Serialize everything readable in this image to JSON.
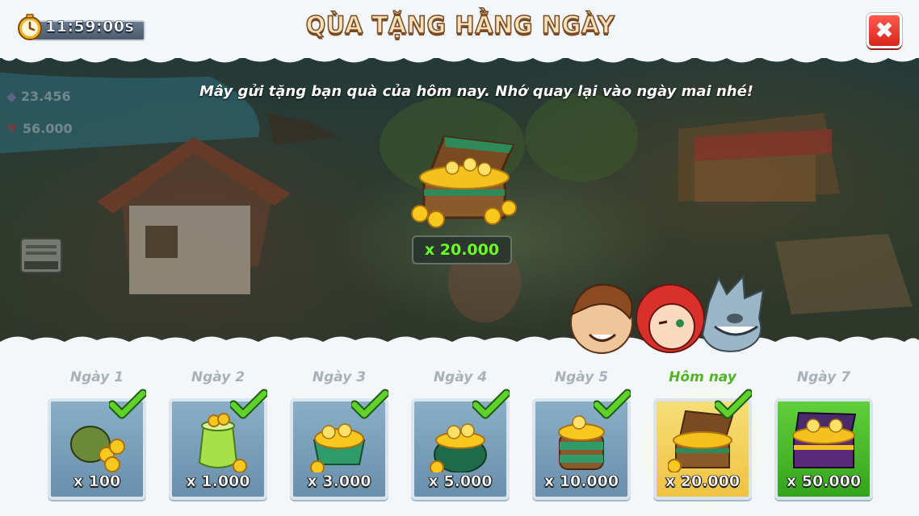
{
  "header": {
    "timer": "11:59:00s",
    "title": "QÙA TẶNG HẰNG NGÀY",
    "close_label": "✖"
  },
  "hud": {
    "gems": "23.456",
    "hearts": "56.000"
  },
  "message": "Mây gửi tặng bạn  quà của hôm nay. Nhớ quay lại vào ngày mai nhé!",
  "today_reward": {
    "amount": "x 20.000"
  },
  "days": [
    {
      "label": "Ngày 1",
      "amount": "x 100",
      "claimed": true
    },
    {
      "label": "Ngày 2",
      "amount": "x 1.000",
      "claimed": true
    },
    {
      "label": "Ngày 3",
      "amount": "x 3.000",
      "claimed": true
    },
    {
      "label": "Ngày 4",
      "amount": "x 5.000",
      "claimed": true
    },
    {
      "label": "Ngày 5",
      "amount": "x 10.000",
      "claimed": true
    },
    {
      "label": "Hôm nay",
      "amount": "x 20.000",
      "claimed": true
    },
    {
      "label": "Ngày 7",
      "amount": "x 50.000",
      "claimed": false
    }
  ],
  "colors": {
    "title_fill": "#f6e1b8",
    "today_label": "#52b424",
    "amount_green": "#6cfb2c",
    "close_red": "#e2342a"
  }
}
